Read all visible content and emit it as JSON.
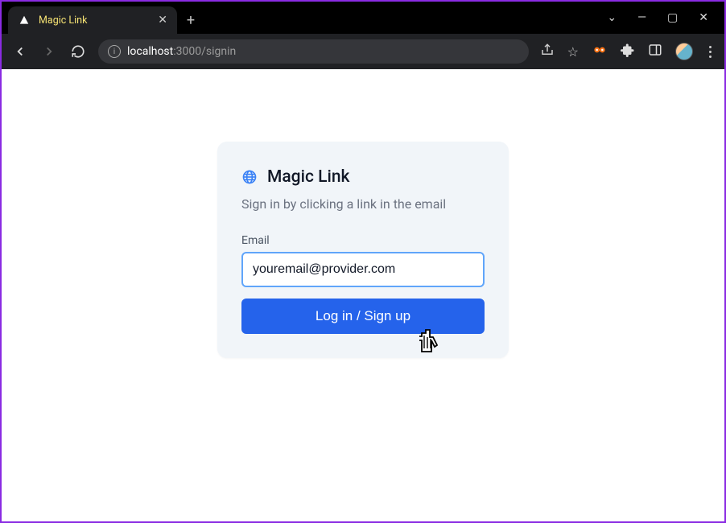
{
  "browser": {
    "tab_title": "Magic Link",
    "url_host": "localhost",
    "url_port_path": ":3000/signin"
  },
  "card": {
    "title": "Magic Link",
    "subtitle": "Sign in by clicking a link in the email",
    "email_label": "Email",
    "email_value": "youremail@provider.com",
    "submit_label": "Log in / Sign up"
  }
}
